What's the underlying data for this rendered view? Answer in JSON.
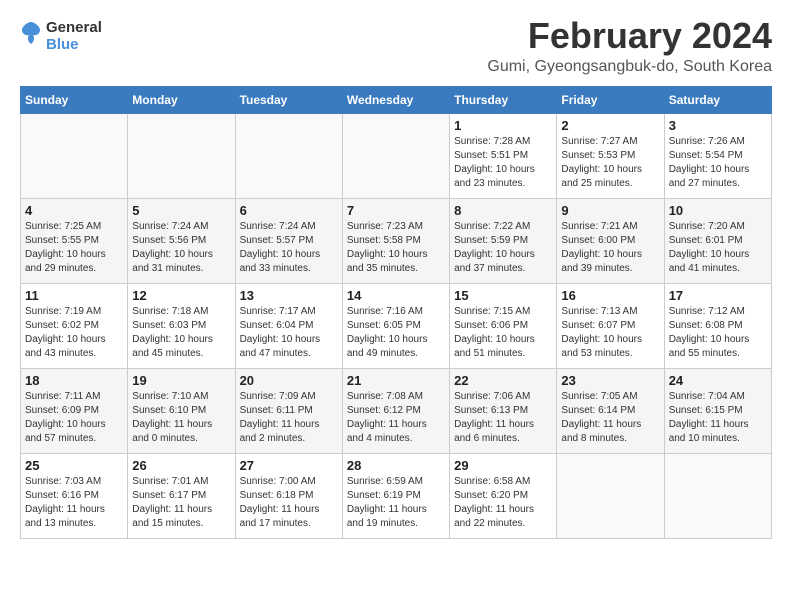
{
  "header": {
    "logo_line1": "General",
    "logo_line2": "Blue",
    "month": "February 2024",
    "location": "Gumi, Gyeongsangbuk-do, South Korea"
  },
  "weekdays": [
    "Sunday",
    "Monday",
    "Tuesday",
    "Wednesday",
    "Thursday",
    "Friday",
    "Saturday"
  ],
  "weeks": [
    [
      {
        "day": "",
        "info": ""
      },
      {
        "day": "",
        "info": ""
      },
      {
        "day": "",
        "info": ""
      },
      {
        "day": "",
        "info": ""
      },
      {
        "day": "1",
        "info": "Sunrise: 7:28 AM\nSunset: 5:51 PM\nDaylight: 10 hours\nand 23 minutes."
      },
      {
        "day": "2",
        "info": "Sunrise: 7:27 AM\nSunset: 5:53 PM\nDaylight: 10 hours\nand 25 minutes."
      },
      {
        "day": "3",
        "info": "Sunrise: 7:26 AM\nSunset: 5:54 PM\nDaylight: 10 hours\nand 27 minutes."
      }
    ],
    [
      {
        "day": "4",
        "info": "Sunrise: 7:25 AM\nSunset: 5:55 PM\nDaylight: 10 hours\nand 29 minutes."
      },
      {
        "day": "5",
        "info": "Sunrise: 7:24 AM\nSunset: 5:56 PM\nDaylight: 10 hours\nand 31 minutes."
      },
      {
        "day": "6",
        "info": "Sunrise: 7:24 AM\nSunset: 5:57 PM\nDaylight: 10 hours\nand 33 minutes."
      },
      {
        "day": "7",
        "info": "Sunrise: 7:23 AM\nSunset: 5:58 PM\nDaylight: 10 hours\nand 35 minutes."
      },
      {
        "day": "8",
        "info": "Sunrise: 7:22 AM\nSunset: 5:59 PM\nDaylight: 10 hours\nand 37 minutes."
      },
      {
        "day": "9",
        "info": "Sunrise: 7:21 AM\nSunset: 6:00 PM\nDaylight: 10 hours\nand 39 minutes."
      },
      {
        "day": "10",
        "info": "Sunrise: 7:20 AM\nSunset: 6:01 PM\nDaylight: 10 hours\nand 41 minutes."
      }
    ],
    [
      {
        "day": "11",
        "info": "Sunrise: 7:19 AM\nSunset: 6:02 PM\nDaylight: 10 hours\nand 43 minutes."
      },
      {
        "day": "12",
        "info": "Sunrise: 7:18 AM\nSunset: 6:03 PM\nDaylight: 10 hours\nand 45 minutes."
      },
      {
        "day": "13",
        "info": "Sunrise: 7:17 AM\nSunset: 6:04 PM\nDaylight: 10 hours\nand 47 minutes."
      },
      {
        "day": "14",
        "info": "Sunrise: 7:16 AM\nSunset: 6:05 PM\nDaylight: 10 hours\nand 49 minutes."
      },
      {
        "day": "15",
        "info": "Sunrise: 7:15 AM\nSunset: 6:06 PM\nDaylight: 10 hours\nand 51 minutes."
      },
      {
        "day": "16",
        "info": "Sunrise: 7:13 AM\nSunset: 6:07 PM\nDaylight: 10 hours\nand 53 minutes."
      },
      {
        "day": "17",
        "info": "Sunrise: 7:12 AM\nSunset: 6:08 PM\nDaylight: 10 hours\nand 55 minutes."
      }
    ],
    [
      {
        "day": "18",
        "info": "Sunrise: 7:11 AM\nSunset: 6:09 PM\nDaylight: 10 hours\nand 57 minutes."
      },
      {
        "day": "19",
        "info": "Sunrise: 7:10 AM\nSunset: 6:10 PM\nDaylight: 11 hours\nand 0 minutes."
      },
      {
        "day": "20",
        "info": "Sunrise: 7:09 AM\nSunset: 6:11 PM\nDaylight: 11 hours\nand 2 minutes."
      },
      {
        "day": "21",
        "info": "Sunrise: 7:08 AM\nSunset: 6:12 PM\nDaylight: 11 hours\nand 4 minutes."
      },
      {
        "day": "22",
        "info": "Sunrise: 7:06 AM\nSunset: 6:13 PM\nDaylight: 11 hours\nand 6 minutes."
      },
      {
        "day": "23",
        "info": "Sunrise: 7:05 AM\nSunset: 6:14 PM\nDaylight: 11 hours\nand 8 minutes."
      },
      {
        "day": "24",
        "info": "Sunrise: 7:04 AM\nSunset: 6:15 PM\nDaylight: 11 hours\nand 10 minutes."
      }
    ],
    [
      {
        "day": "25",
        "info": "Sunrise: 7:03 AM\nSunset: 6:16 PM\nDaylight: 11 hours\nand 13 minutes."
      },
      {
        "day": "26",
        "info": "Sunrise: 7:01 AM\nSunset: 6:17 PM\nDaylight: 11 hours\nand 15 minutes."
      },
      {
        "day": "27",
        "info": "Sunrise: 7:00 AM\nSunset: 6:18 PM\nDaylight: 11 hours\nand 17 minutes."
      },
      {
        "day": "28",
        "info": "Sunrise: 6:59 AM\nSunset: 6:19 PM\nDaylight: 11 hours\nand 19 minutes."
      },
      {
        "day": "29",
        "info": "Sunrise: 6:58 AM\nSunset: 6:20 PM\nDaylight: 11 hours\nand 22 minutes."
      },
      {
        "day": "",
        "info": ""
      },
      {
        "day": "",
        "info": ""
      }
    ]
  ]
}
